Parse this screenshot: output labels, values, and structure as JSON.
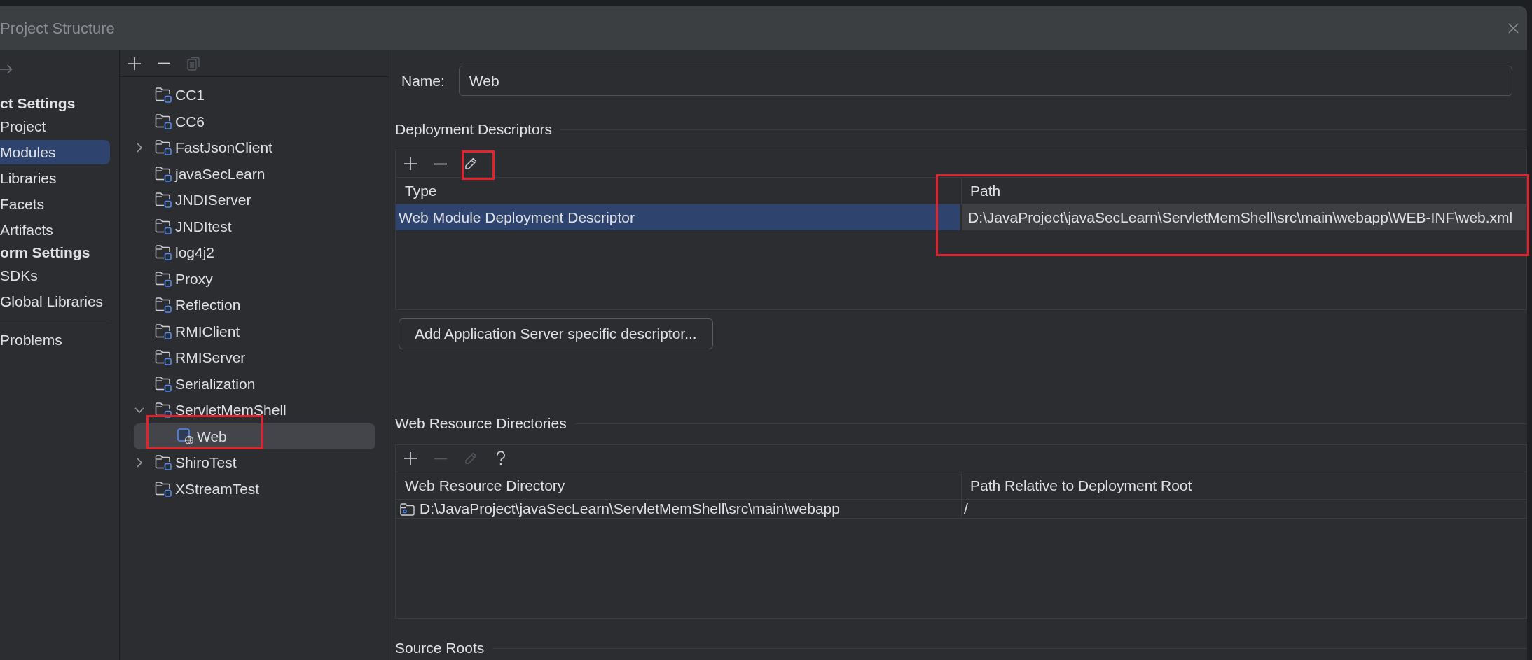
{
  "window": {
    "title": "Project Structure"
  },
  "sidebar": {
    "items": [
      {
        "kind": "header",
        "label": "ct Settings"
      },
      {
        "kind": "item",
        "label": "Project",
        "selected": false
      },
      {
        "kind": "item",
        "label": "Modules",
        "selected": true
      },
      {
        "kind": "item",
        "label": "Libraries",
        "selected": false
      },
      {
        "kind": "item",
        "label": "Facets",
        "selected": false
      },
      {
        "kind": "item",
        "label": "Artifacts",
        "selected": false
      },
      {
        "kind": "header",
        "label": "orm Settings"
      },
      {
        "kind": "item",
        "label": "SDKs",
        "selected": false
      },
      {
        "kind": "item",
        "label": "Global Libraries",
        "selected": false
      },
      {
        "kind": "separator"
      },
      {
        "kind": "item",
        "label": "Problems",
        "selected": false
      }
    ]
  },
  "module_tree": {
    "toolbar": [
      {
        "kind": "add",
        "disabled": false
      },
      {
        "kind": "remove",
        "disabled": false
      },
      {
        "kind": "copy",
        "disabled": true
      }
    ],
    "items": [
      {
        "kind": "module",
        "label": "CC1",
        "selected": false,
        "annotated": false
      },
      {
        "kind": "module",
        "label": "CC6",
        "selected": false,
        "annotated": false
      },
      {
        "kind": "module",
        "label": "FastJsonClient",
        "expanded": false,
        "selected": false,
        "annotated": false
      },
      {
        "kind": "module",
        "label": "javaSecLearn",
        "selected": false,
        "annotated": false
      },
      {
        "kind": "module",
        "label": "JNDIServer",
        "selected": false,
        "annotated": false
      },
      {
        "kind": "module",
        "label": "JNDItest",
        "selected": false,
        "annotated": false
      },
      {
        "kind": "module",
        "label": "log4j2",
        "selected": false,
        "annotated": false
      },
      {
        "kind": "module",
        "label": "Proxy",
        "selected": false,
        "annotated": false
      },
      {
        "kind": "module",
        "label": "Reflection",
        "selected": false,
        "annotated": false
      },
      {
        "kind": "module",
        "label": "RMIClient",
        "selected": false,
        "annotated": false
      },
      {
        "kind": "module",
        "label": "RMIServer",
        "selected": false,
        "annotated": false
      },
      {
        "kind": "module",
        "label": "Serialization",
        "selected": false,
        "annotated": false
      },
      {
        "kind": "module",
        "label": "ServletMemShell",
        "expanded": true,
        "selected": false,
        "annotated": false,
        "children": [
          {
            "kind": "web",
            "label": "Web",
            "selected": true,
            "annotated": true
          }
        ]
      },
      {
        "kind": "module",
        "label": "ShiroTest",
        "expanded": false,
        "selected": false,
        "annotated": false
      },
      {
        "kind": "module",
        "label": "XStreamTest",
        "selected": false,
        "annotated": false
      }
    ]
  },
  "details": {
    "name": {
      "label": "Name:",
      "value": "Web"
    },
    "deployment_descriptors": {
      "title": "Deployment Descriptors",
      "toolbar": [
        {
          "kind": "add",
          "disabled": false,
          "annotated": false
        },
        {
          "kind": "remove",
          "disabled": false,
          "annotated": false
        },
        {
          "kind": "edit",
          "disabled": false,
          "annotated": true
        }
      ],
      "columns": [
        {
          "label": "Type",
          "annotated": false
        },
        {
          "label": "Path",
          "annotated": true
        }
      ],
      "rows": [
        {
          "selected": true,
          "cells": [
            "Web Module Deployment Descriptor",
            "D:\\JavaProject\\javaSecLearn\\ServletMemShell\\src\\main\\webapp\\WEB-INF\\web.xml"
          ]
        }
      ],
      "add_button": "Add Application Server specific descriptor..."
    },
    "web_resource_directories": {
      "title": "Web Resource Directories",
      "toolbar": [
        {
          "kind": "add",
          "disabled": false
        },
        {
          "kind": "remove",
          "disabled": true
        },
        {
          "kind": "edit",
          "disabled": true
        },
        {
          "kind": "help",
          "disabled": false
        }
      ],
      "columns": [
        {
          "label": "Web Resource Directory"
        },
        {
          "label": "Path Relative to Deployment Root"
        }
      ],
      "rows": [
        {
          "kind": "directory",
          "selected": false,
          "cells": [
            "D:\\JavaProject\\javaSecLearn\\ServletMemShell\\src\\main\\webapp",
            "/"
          ]
        }
      ]
    },
    "source_roots": {
      "title": "Source Roots"
    }
  }
}
